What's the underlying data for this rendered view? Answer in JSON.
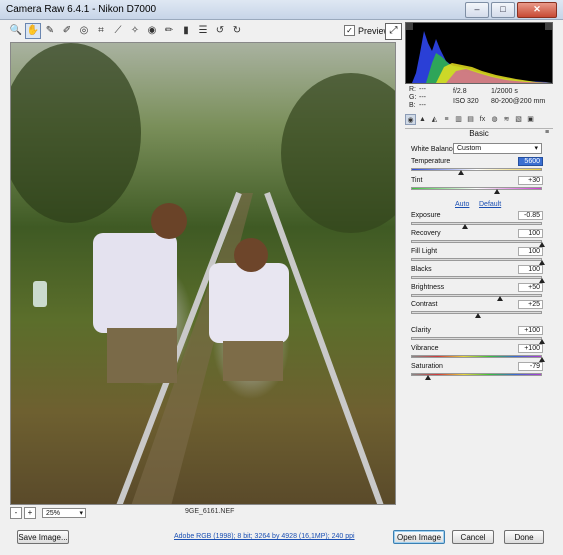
{
  "window": {
    "title": "Camera Raw 6.4.1  -  Nikon D7000"
  },
  "window_buttons": [
    "–",
    "□",
    "✕"
  ],
  "toolbar": {
    "tools": [
      {
        "name": "zoom-tool-icon",
        "glyph": "🔍"
      },
      {
        "name": "hand-tool-icon",
        "glyph": "✋"
      },
      {
        "name": "white-balance-tool-icon",
        "glyph": "✎"
      },
      {
        "name": "color-sampler-tool-icon",
        "glyph": "✐"
      },
      {
        "name": "targeted-adjustment-tool-icon",
        "glyph": "◎"
      },
      {
        "name": "crop-tool-icon",
        "glyph": "⌗"
      },
      {
        "name": "straighten-tool-icon",
        "glyph": "⟋"
      },
      {
        "name": "spot-removal-tool-icon",
        "glyph": "✧"
      },
      {
        "name": "red-eye-tool-icon",
        "glyph": "◉"
      },
      {
        "name": "adjustment-brush-icon",
        "glyph": "✏"
      },
      {
        "name": "graduated-filter-icon",
        "glyph": "▮"
      },
      {
        "name": "preferences-icon",
        "glyph": "☰"
      },
      {
        "name": "rotate-ccw-icon",
        "glyph": "↺"
      },
      {
        "name": "rotate-cw-icon",
        "glyph": "↻"
      }
    ],
    "preview_label": "Preview",
    "preview_checked": "✓"
  },
  "image": {
    "filename": "9GE_6161.NEF",
    "zoom": "25%"
  },
  "zoom_buttons": [
    "-",
    "+"
  ],
  "camera_info": {
    "r_label": "R:",
    "r_val": "---",
    "g_label": "G:",
    "g_val": "---",
    "b_label": "B:",
    "b_val": "---",
    "aperture": "f/2.8",
    "shutter": "1/2000 s",
    "iso": "ISO 320",
    "lens": "80-200@200 mm"
  },
  "panel": {
    "title": "Basic",
    "menu_glyph": "≡",
    "tabs": [
      "◉",
      "▲",
      "◭",
      "≡",
      "▥",
      "▤",
      "fx",
      "◍",
      "≋",
      "▧",
      "▣"
    ],
    "white_balance_label": "White Balance:",
    "white_balance_value": "Custom",
    "auto_label": "Auto",
    "default_label": "Default",
    "sliders": [
      {
        "label": "Temperature",
        "value": "5600",
        "level": 0.37
      },
      {
        "label": "Tint",
        "value": "+30",
        "level": 0.65
      },
      {
        "label": "Exposure",
        "value": "-0.85",
        "level": 0.4
      },
      {
        "label": "Recovery",
        "value": "100",
        "level": 1.0
      },
      {
        "label": "Fill Light",
        "value": "100",
        "level": 1.0
      },
      {
        "label": "Blacks",
        "value": "100",
        "level": 1.0
      },
      {
        "label": "Brightness",
        "value": "+50",
        "level": 0.67
      },
      {
        "label": "Contrast",
        "value": "+25",
        "level": 0.5
      },
      {
        "label": "Clarity",
        "value": "+100",
        "level": 1.0
      },
      {
        "label": "Vibrance",
        "value": "+100",
        "level": 1.0
      },
      {
        "label": "Saturation",
        "value": "-79",
        "level": 0.11
      }
    ]
  },
  "bottom": {
    "save_label": "Save Image...",
    "workflow": "Adobe RGB (1998); 8 bit; 3264 by 4928 (16,1MP); 240 ppi",
    "open_label": "Open Image",
    "cancel_label": "Cancel",
    "done_label": "Done"
  }
}
